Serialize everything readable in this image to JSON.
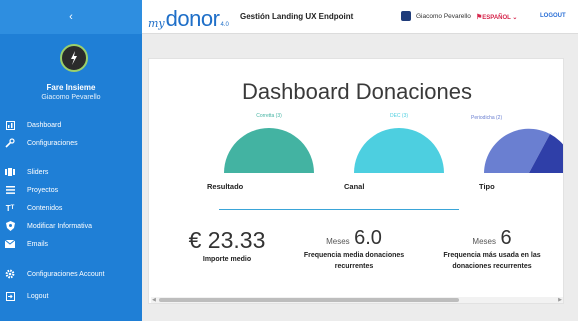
{
  "sidebar": {
    "collapse_glyph": "‹",
    "org_name": "Fare Insieme",
    "user_name": "Giacomo Pevarello",
    "items": [
      {
        "label": "Dashboard",
        "icon": "dashboard-icon"
      },
      {
        "label": "Configuraciones",
        "icon": "wrench-icon"
      },
      {
        "label": "Sliders",
        "icon": "sliders-icon"
      },
      {
        "label": "Proyectos",
        "icon": "list-icon"
      },
      {
        "label": "Contenidos",
        "icon": "text-icon"
      },
      {
        "label": "Modificar Informativa",
        "icon": "shield-icon"
      },
      {
        "label": "Emails",
        "icon": "mail-icon"
      },
      {
        "label": "Configuraciones Account",
        "icon": "gear-icon"
      },
      {
        "label": "Logout",
        "icon": "logout-icon"
      }
    ],
    "bg_color": "#1f7fd6"
  },
  "topbar": {
    "logo_my": "my",
    "logo_donor": "donor",
    "logo_version": "4.0",
    "title": "Gestión Landing UX Endpoint",
    "user_name": "Giacomo Pevarello",
    "language": "ESPAÑOL ⌄",
    "logout": "LOGOUT"
  },
  "main": {
    "title": "Dashboard Donaciones",
    "charts": [
      {
        "label": "Resultado",
        "slice_label": "Corretta (3)",
        "color": "#43b3a2"
      },
      {
        "label": "Canal",
        "slice_label": "DEC (3)",
        "color": "#4dcfe0"
      },
      {
        "label": "Tipo",
        "slice_label": "Periodicha (2)",
        "color": "#6a7fd1",
        "color2": "#2f3fa8"
      }
    ],
    "stats": {
      "importe_value": "€ 23.33",
      "importe_label": "Importe medio",
      "freq_prefix": "Meses",
      "freq_value": "6.0",
      "freq_label_1": "Frequencia media donaciones",
      "freq_label_2": "recurrentes",
      "top_prefix": "Meses",
      "top_value": "6",
      "top_label_1": "Frequencia más usada en las",
      "top_label_2": "donaciones recurrentes"
    }
  },
  "chart_data": [
    {
      "type": "pie",
      "title": "Resultado",
      "categories": [
        "Corretta"
      ],
      "values": [
        3
      ]
    },
    {
      "type": "pie",
      "title": "Canal",
      "categories": [
        "DEC"
      ],
      "values": [
        3
      ]
    },
    {
      "type": "pie",
      "title": "Tipo",
      "categories": [
        "Periodicha",
        ""
      ],
      "values": [
        2,
        1
      ]
    }
  ]
}
